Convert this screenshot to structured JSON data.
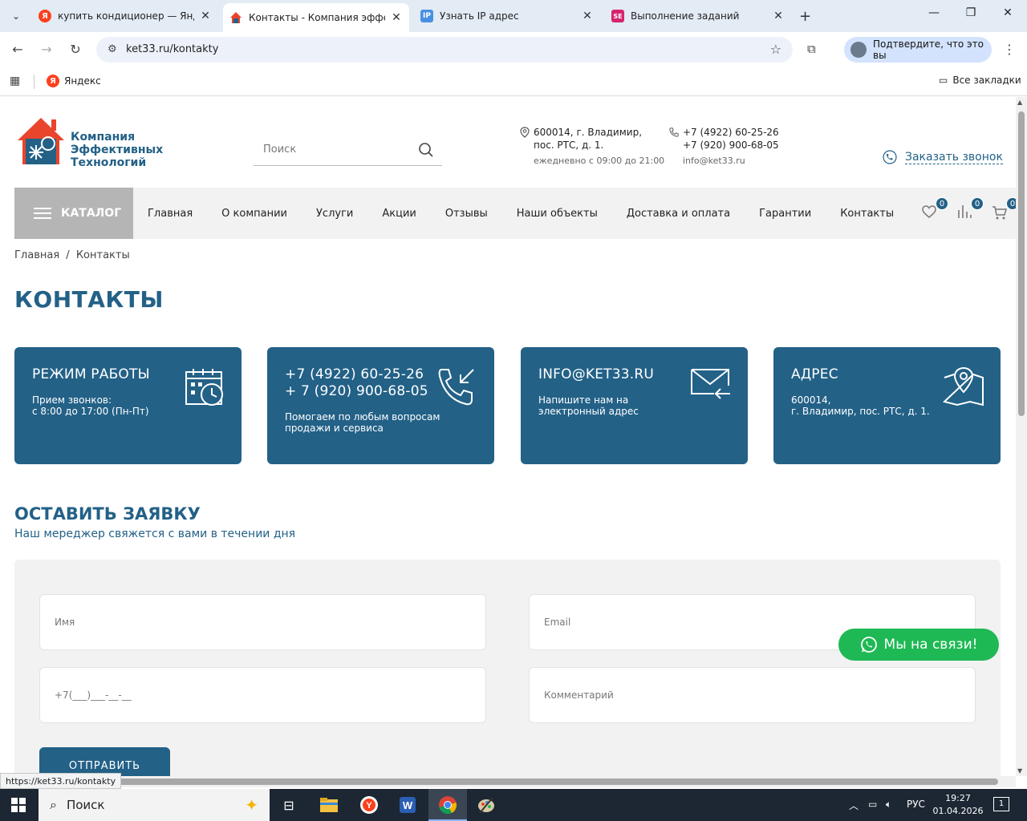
{
  "browser": {
    "tabs": [
      {
        "title": "купить кондиционер — Яндекс",
        "favicon": "yandex-icon"
      },
      {
        "title": "Контакты - Компания эффективных технологий",
        "favicon": "house-icon"
      },
      {
        "title": "Узнать IP адрес",
        "favicon": "ip-icon"
      },
      {
        "title": "Выполнение заданий",
        "favicon": "se-icon"
      }
    ],
    "url": "ket33.ru/kontakty",
    "profile_label": "Подтвердите, что это вы",
    "bookmarks": {
      "yandex": "Яндекс",
      "all": "Все закладки"
    },
    "status_url": "https://ket33.ru/kontakty"
  },
  "header": {
    "logo_lines": [
      "Компания",
      "Эффективных",
      "Технологий"
    ],
    "search_placeholder": "Поиск",
    "address_line1": "600014, г. Владимир,",
    "address_line2": "пос. РТС, д. 1.",
    "hours": "ежедневно с 09:00 до 21:00",
    "phone1": "+7 (4922) 60-25-26",
    "phone2": "+7 (920) 900-68-05",
    "email": "info@ket33.ru",
    "callback": "Заказать звонок"
  },
  "menu": {
    "catalog": "КАТАЛОГ",
    "items": [
      "Главная",
      "О компании",
      "Услуги",
      "Акции",
      "Отзывы",
      "Наши объекты",
      "Доставка и оплата",
      "Гарантии",
      "Контакты"
    ],
    "favorites_count": "0",
    "compare_count": "0",
    "cart_count": "0"
  },
  "breadcrumb": {
    "home": "Главная",
    "sep": "/",
    "current": "Контакты"
  },
  "page_title": "КОНТАКТЫ",
  "cards": [
    {
      "title": "РЕЖИМ РАБОТЫ",
      "desc": "Прием звонков:\nс 8:00 до 17:00 (Пн-Пт)"
    },
    {
      "title": "+7 (4922) 60-25-26\n+ 7 (920) 900-68-05",
      "desc": "Помогаем по любым вопросам\nпродажи и сервиса"
    },
    {
      "title": "INFO@KET33.RU",
      "desc": "Напишите нам на\nэлектронный адрес"
    },
    {
      "title": "АДРЕС",
      "desc": "600014,\nг. Владимир, пос. РТС, д. 1."
    }
  ],
  "form": {
    "title": "ОСТАВИТЬ ЗАЯВКУ",
    "subtitle": "Наш мереджер свяжется с вами в течении дня",
    "name_placeholder": "Имя",
    "email_placeholder": "Email",
    "phone_placeholder": "+7(___)___-__-__",
    "comment_placeholder": "Комментарий",
    "submit": "ОТПРАВИТЬ"
  },
  "whatsapp": "Мы на связи!",
  "taskbar": {
    "search": "Поиск",
    "lang": "РУС",
    "time": "19:27",
    "date": "01.04.2026",
    "notifications": "1"
  },
  "colors": {
    "brand": "#236187",
    "accent": "#e8452c",
    "whatsapp": "#1eb954"
  }
}
